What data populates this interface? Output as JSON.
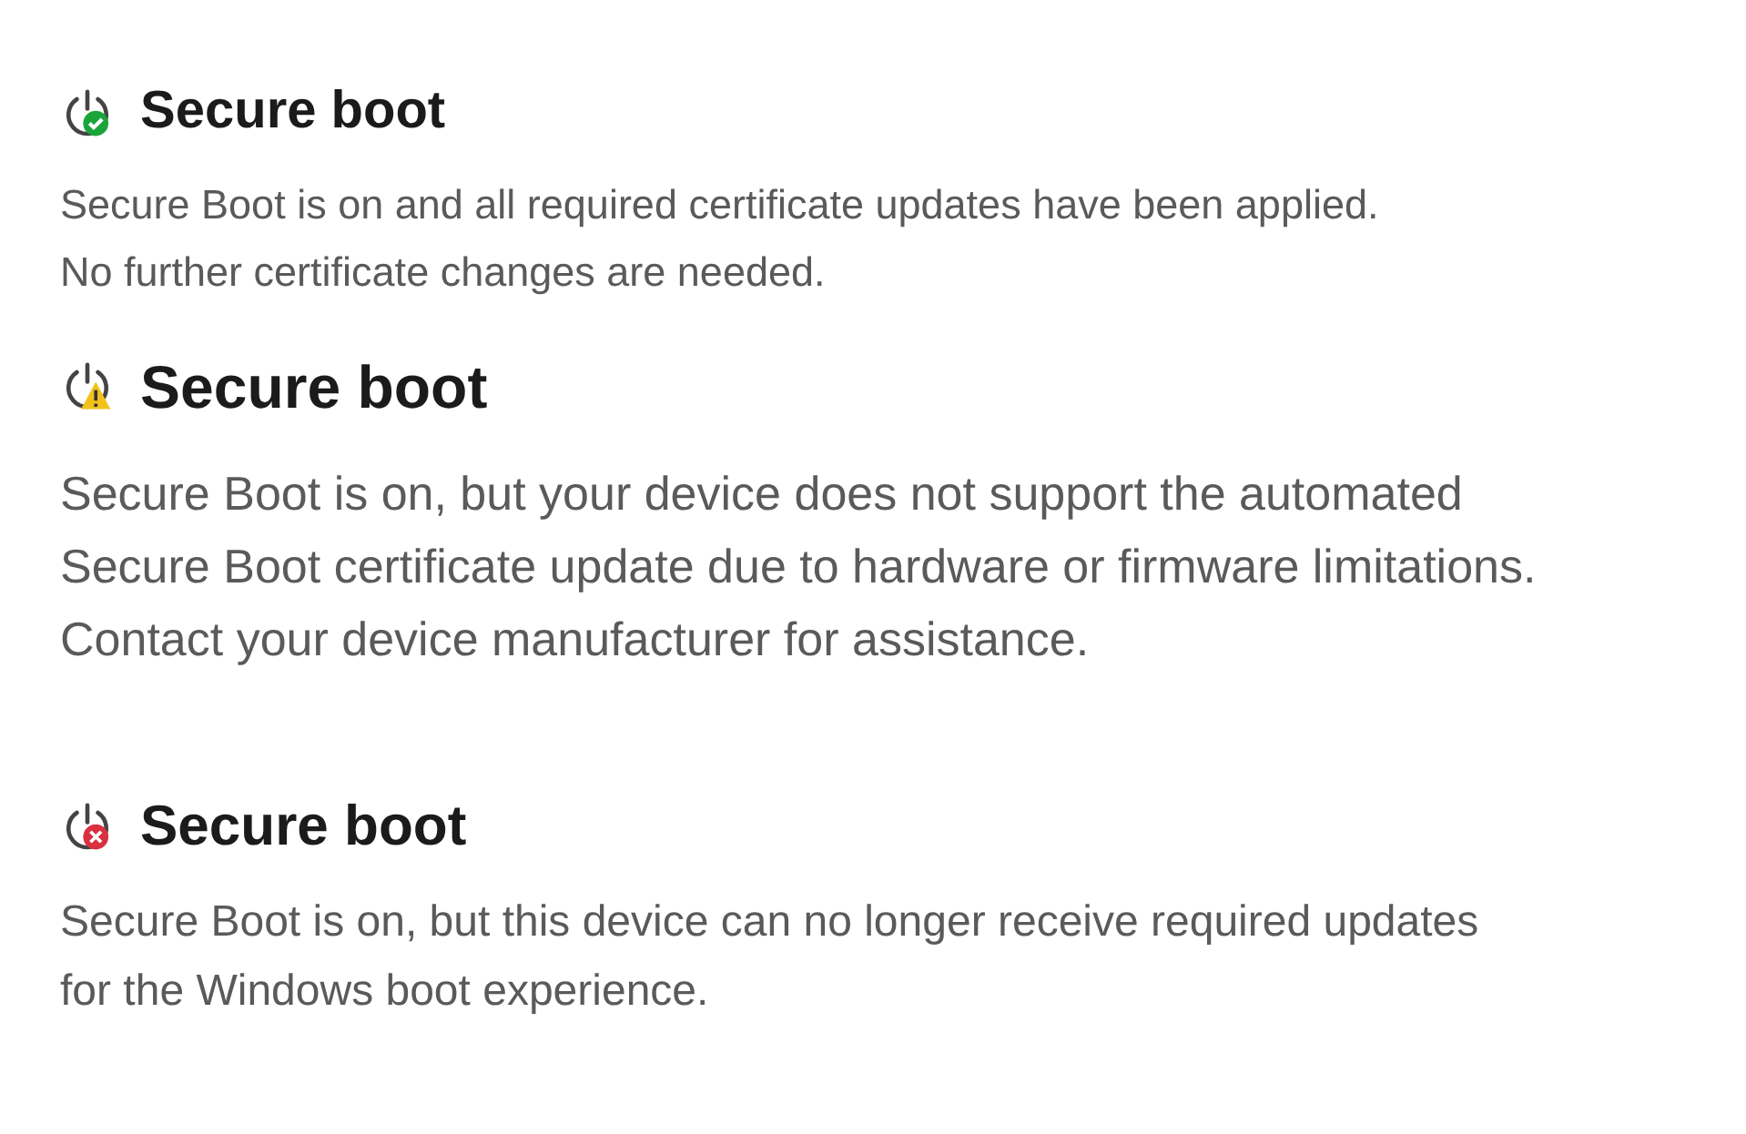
{
  "sections": [
    {
      "title": "Secure boot",
      "kind": "ok",
      "lines": [
        "Secure Boot is on and all required certificate updates have been applied.",
        "No further certificate changes are needed."
      ]
    },
    {
      "title": "Secure boot",
      "kind": "warning",
      "lines": [
        "Secure Boot is on, but your device does not support the automated",
        "Secure Boot certificate update due to hardware or firmware limitations.",
        "Contact your device manufacturer for assistance."
      ]
    },
    {
      "title": "Secure boot",
      "kind": "error",
      "lines": [
        "Secure Boot is on, but this device can no longer receive required updates",
        "for the Windows boot experience."
      ]
    }
  ]
}
